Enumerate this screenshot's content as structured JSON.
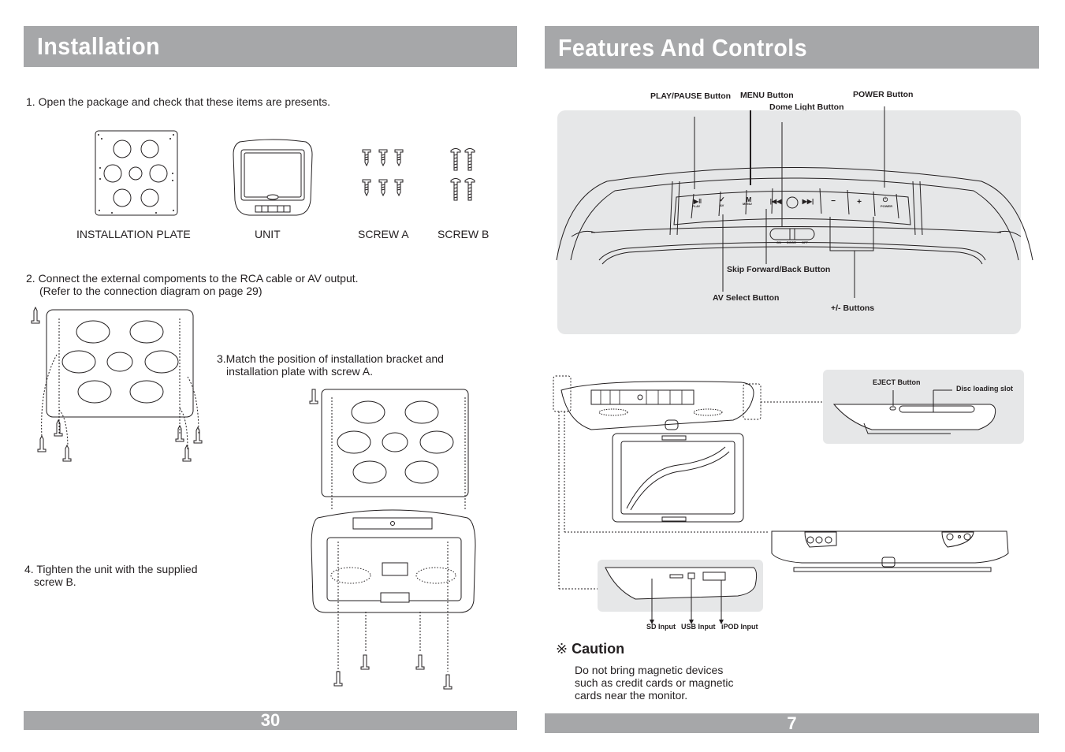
{
  "left_page": {
    "title": "Installation",
    "page_number": "30",
    "step1": "1. Open the package and check that these items are presents.",
    "items": [
      {
        "label": "INSTALLATION PLATE"
      },
      {
        "label": "UNIT"
      },
      {
        "label": "SCREW A"
      },
      {
        "label": "SCREW B"
      }
    ],
    "step2_line1": "2. Connect the external compoments to the RCA cable or AV output.",
    "step2_line2": "(Refer to the connection diagram on page 29)",
    "step3_line1": "3.Match the position of installation bracket and",
    "step3_line2": "installation plate with screw A.",
    "step4_line1": "4. Tighten the unit with the supplied",
    "step4_line2": "screw B."
  },
  "right_page": {
    "title": "Features And Controls",
    "page_number": "7",
    "control_callouts": {
      "play_pause": "PLAY/PAUSE Button",
      "menu": "MENU Button",
      "dome_light": "Dome Light Button",
      "power": "POWER Button",
      "skip": "Skip Forward/Back Button",
      "av_select": "AV Select Button",
      "plus_minus": "+/- Buttons"
    },
    "panel_button_labels": {
      "play": "PLAY",
      "av": "AV",
      "menu": "MENU",
      "minus": "−",
      "plus": "+",
      "power": "POWER",
      "switch_on": "ON",
      "switch_door": "DOOR",
      "switch_off": "OFF"
    },
    "side_callouts": {
      "eject": "EJECT Button",
      "disc_slot": "Disc loading slot",
      "sd": "SD Input",
      "usb": "USB Input",
      "ipod": "iPOD Input"
    },
    "caution": {
      "symbol": "※",
      "title": "Caution",
      "line1": "Do not bring magnetic devices",
      "line2": "such as credit cards or magnetic",
      "line3": "cards near the monitor."
    }
  }
}
